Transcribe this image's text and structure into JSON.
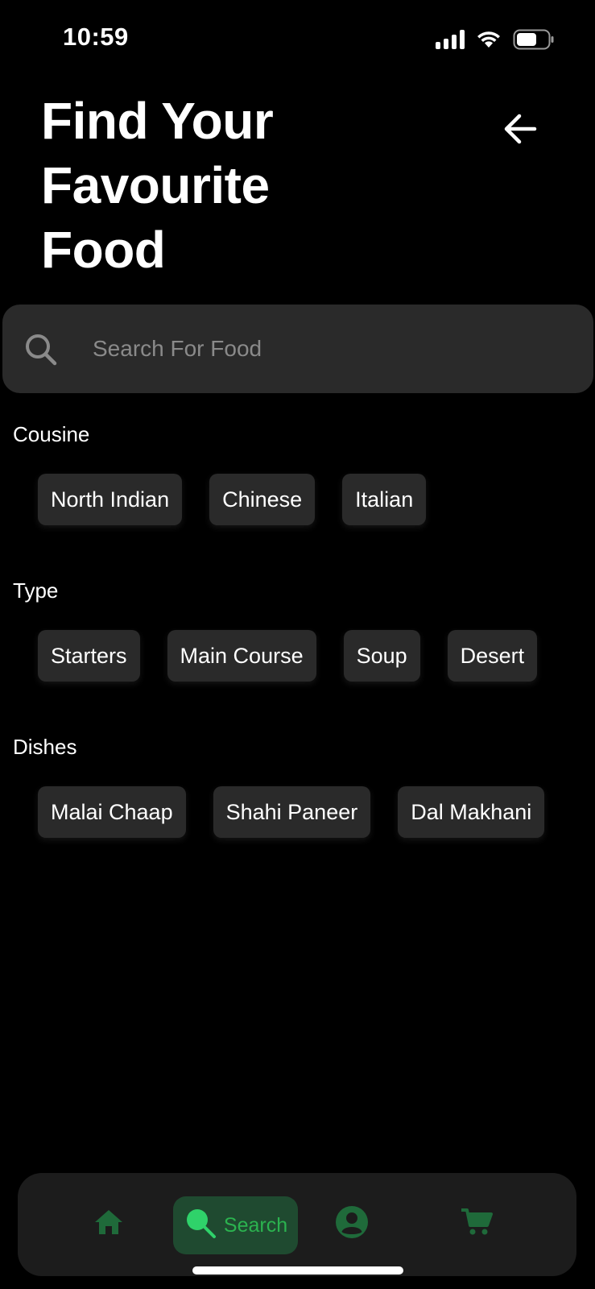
{
  "status_bar": {
    "time": "10:59"
  },
  "header": {
    "title": "Find Your Favourite Food",
    "back_icon": "arrow-left-icon"
  },
  "search": {
    "placeholder": "Search For Food",
    "value": "",
    "icon": "search-icon"
  },
  "sections": {
    "cuisine": {
      "title": "Cousine",
      "chips": [
        "North Indian",
        "Chinese",
        "Italian"
      ]
    },
    "type": {
      "title": "Type",
      "chips": [
        "Starters",
        "Main Course",
        "Soup",
        "Desert"
      ]
    },
    "dishes": {
      "title": "Dishes",
      "chips": [
        "Malai Chaap",
        "Shahi Paneer",
        "Dal Makhani"
      ]
    }
  },
  "bottom_nav": {
    "items": [
      {
        "icon": "home-icon",
        "label": ""
      },
      {
        "icon": "search-icon",
        "label": "Search",
        "active": true
      },
      {
        "icon": "profile-icon",
        "label": ""
      },
      {
        "icon": "cart-icon",
        "label": ""
      }
    ]
  },
  "colors": {
    "background": "#000000",
    "surface": "#2a2a2a",
    "nav_background": "#1c1c1c",
    "accent": "#2bb34f",
    "accent_dim": "#1f6a3a",
    "active_pill": "#1f4a30",
    "placeholder": "#8a8a8a"
  }
}
